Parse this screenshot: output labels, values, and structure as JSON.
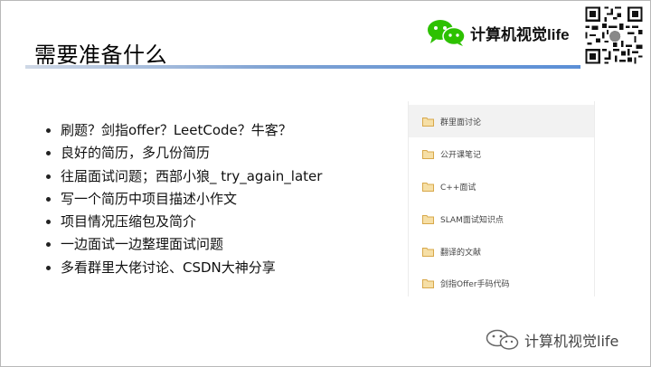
{
  "slide": {
    "title": "需要准备什么",
    "brand": {
      "name": "计算机视觉life"
    },
    "bullets": [
      "刷题？剑指offer？LeetCode？牛客？",
      "良好的简历，多几份简历",
      "往届面试问题；西部小狼_ try_again_later",
      "写一个简历中项目描述小作文",
      "项目情况压缩包及简介",
      "一边面试一边整理面试问题",
      "多看群里大佬讨论、CSDN大神分享"
    ],
    "panel": {
      "items": [
        "群里面讨论",
        "公开课笔记",
        "C++面试",
        "SLAM面试知识点",
        "翻译的文献",
        "剑指Offer手码代码"
      ],
      "active_index": 0
    },
    "footer": {
      "watermark": "计算机视觉life"
    }
  },
  "icons": {
    "brand": "wechat-icon",
    "panel_item": "folder-icon",
    "qr": "qr-code-icon"
  },
  "colors": {
    "accent_rule": "#5b8fd6",
    "wechat_green": "#2dc100",
    "folder": "#e0b45a"
  }
}
